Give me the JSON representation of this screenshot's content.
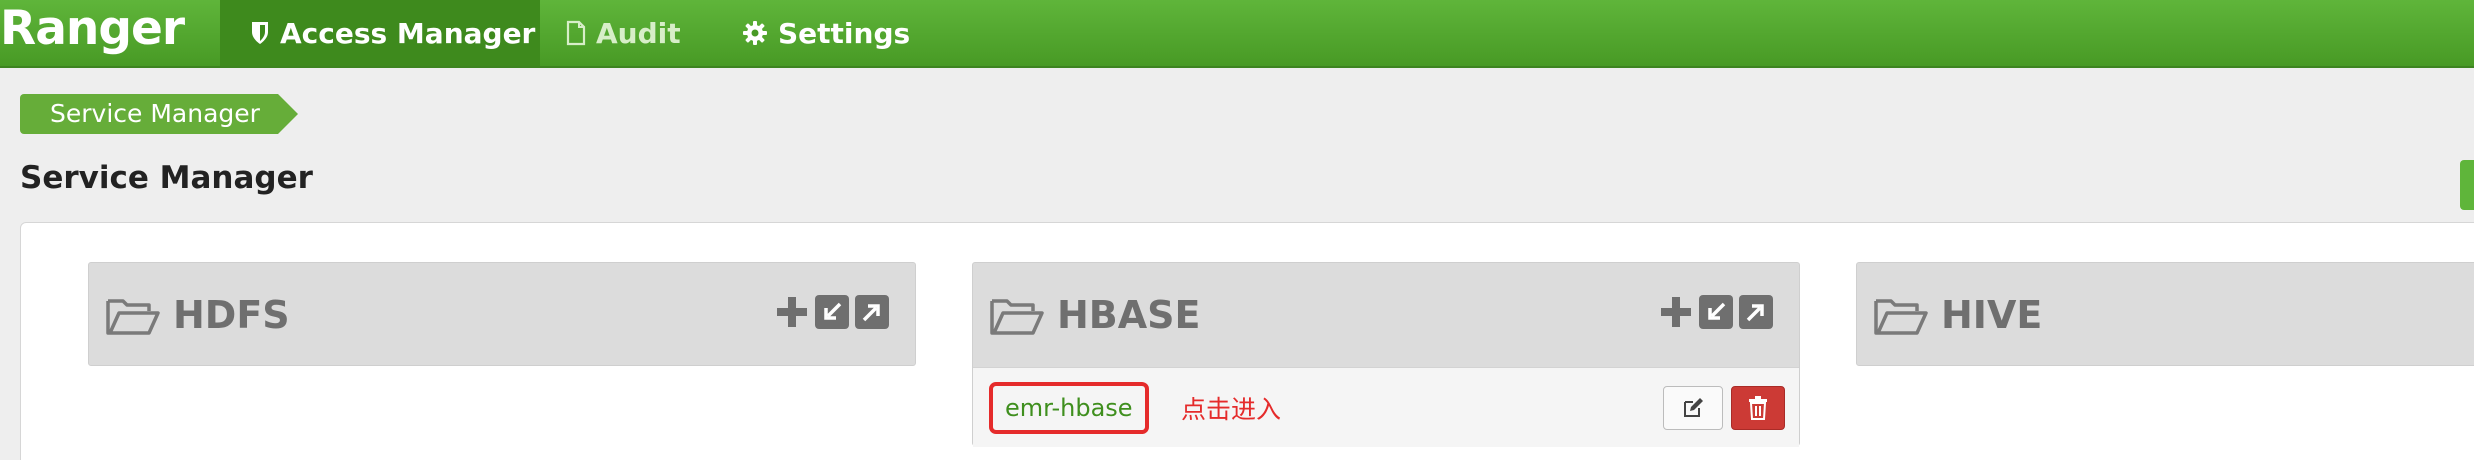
{
  "navbar": {
    "brand": "Ranger",
    "items": [
      {
        "label": "Access Manager",
        "icon": "shield-icon",
        "active": true
      },
      {
        "label": "Audit",
        "icon": "file-icon",
        "active": false
      },
      {
        "label": "Settings",
        "icon": "gear-icon",
        "active": false
      }
    ]
  },
  "breadcrumb": {
    "label": "Service Manager"
  },
  "page": {
    "title": "Service Manager"
  },
  "services": [
    {
      "name": "HDFS",
      "repos": []
    },
    {
      "name": "HBASE",
      "repos": [
        {
          "name": "emr-hbase"
        }
      ]
    },
    {
      "name": "HIVE",
      "repos": []
    }
  ],
  "annotation": {
    "text": "点击进入"
  },
  "colors": {
    "brand_green": "#4fa52c",
    "highlight_red": "#e52b2b",
    "delete_red": "#cc3a35"
  }
}
